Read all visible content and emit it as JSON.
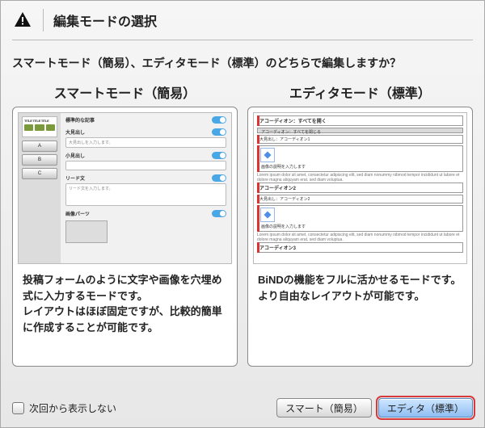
{
  "header": {
    "title": "編集モードの選択"
  },
  "question": "スマートモード（簡易）、エディタモード（標準）のどちらで編集しますか？",
  "modes": {
    "smart": {
      "title": "スマートモード（簡易）",
      "description": "投稿フォームのように文字や画像を穴埋め式に入力するモードです。\nレイアウトはほぼ固定ですが、比較的簡単に作成することが可能です。",
      "preview": {
        "card_title": "TITLE TITLE TITLE",
        "side_buttons": [
          "A",
          "B",
          "C"
        ],
        "heading_label": "標準的な記事",
        "big_heading_label": "大見出し",
        "big_heading_value": "大見出しを入力します。",
        "small_heading_label": "小見出し",
        "lead_label": "リード文",
        "lead_value": "リード文を入力します。",
        "image_label": "画像パーツ"
      }
    },
    "editor": {
      "title": "エディタモード（標準）",
      "description": "BiNDの機能をフルに活かせるモードです。\nより自由なレイアウトが可能です。",
      "preview": {
        "open_all": "アコーディオン：すべてを開く",
        "close_all": "アコーディオン：すべてを閉じる",
        "acc1_title": "アコーディオン1",
        "acc1_sub": "大見出し：アコーディオン1",
        "acc1_caption": "画像の説明を入力します",
        "acc2_title": "アコーディオン2",
        "acc2_sub": "大見出し：アコーディオン2",
        "acc2_caption": "画像の説明を入力します",
        "acc3_title": "アコーディオン3",
        "lorem": "Lorem ipsum dolor sit amet, consectetur adipiscing elit, sed diam nonummy nibmod tempor incididunt ut labore et dolore magna aliquyam erat, sed diam voluptua."
      }
    }
  },
  "footer": {
    "dont_show_label": "次回から表示しない",
    "dont_show_checked": false,
    "smart_button": "スマート（簡易）",
    "editor_button": "エディタ（標準）"
  }
}
